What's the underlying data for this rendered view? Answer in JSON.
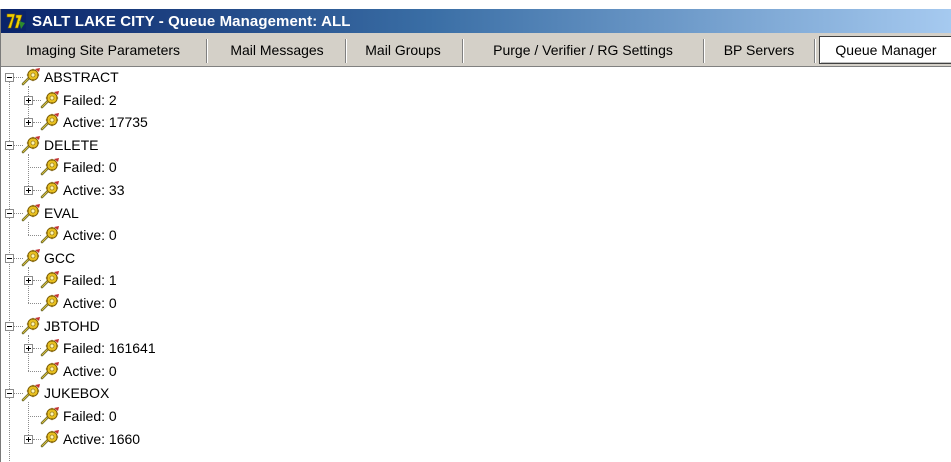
{
  "window": {
    "title": "SALT LAKE CITY - Queue Management: ALL",
    "title_icon": "app-logo-icon"
  },
  "tabs": [
    {
      "label": "Imaging Site Parameters",
      "active": false
    },
    {
      "label": "Mail Messages",
      "active": false
    },
    {
      "label": "Mail Groups",
      "active": false
    },
    {
      "label": "Purge / Verifier / RG Settings",
      "active": false
    },
    {
      "label": "BP Servers",
      "active": false
    },
    {
      "label": "Queue Manager",
      "active": true
    }
  ],
  "tree": [
    {
      "label": "ABSTRACT",
      "children": [
        {
          "label": "Failed: 2",
          "expandable": true
        },
        {
          "label": "Active: 17735",
          "expandable": true
        }
      ]
    },
    {
      "label": "DELETE",
      "children": [
        {
          "label": "Failed: 0",
          "expandable": false
        },
        {
          "label": "Active: 33",
          "expandable": true
        }
      ]
    },
    {
      "label": "EVAL",
      "children": [
        {
          "label": "Active: 0",
          "expandable": false
        }
      ]
    },
    {
      "label": "GCC",
      "children": [
        {
          "label": "Failed: 1",
          "expandable": true
        },
        {
          "label": "Active: 0",
          "expandable": false
        }
      ]
    },
    {
      "label": "JBTOHD",
      "children": [
        {
          "label": "Failed: 161641",
          "expandable": true
        },
        {
          "label": "Active: 0",
          "expandable": false
        }
      ]
    },
    {
      "label": "JUKEBOX",
      "children": [
        {
          "label": "Failed: 0",
          "expandable": false
        },
        {
          "label": "Active: 1660",
          "expandable": true
        }
      ]
    }
  ],
  "icons": {
    "tree_node": "gear-icon",
    "expand": "plus-box-icon",
    "collapse": "minus-box-icon"
  },
  "colors": {
    "titlebar_start": "#0a246a",
    "titlebar_end": "#a6caf0",
    "tabbar_bg": "#d4d0c8"
  }
}
